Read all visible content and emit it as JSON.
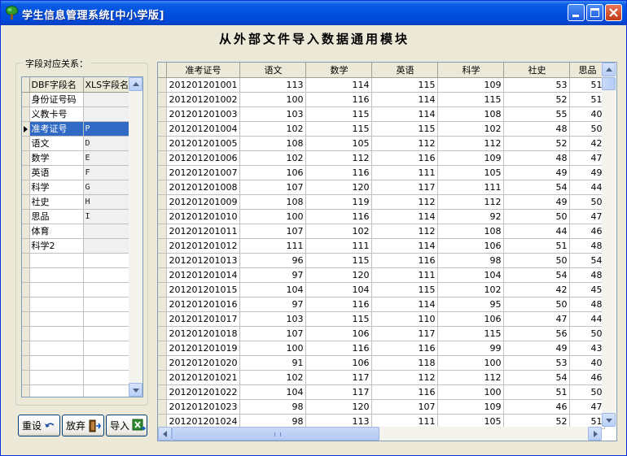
{
  "window": {
    "title": "学生信息管理系统[中小学版]"
  },
  "heading": "从外部文件导入数据通用模块",
  "mapping": {
    "legend": "字段对应关系：",
    "headers": {
      "dbf": "DBF字段名",
      "xls": "XLS字段名"
    },
    "selected_index": 2,
    "rows": [
      {
        "dbf": "身份证号码",
        "xls": ""
      },
      {
        "dbf": "义教卡号",
        "xls": ""
      },
      {
        "dbf": "准考证号",
        "xls": "P"
      },
      {
        "dbf": "语文",
        "xls": "D"
      },
      {
        "dbf": "数学",
        "xls": "E"
      },
      {
        "dbf": "英语",
        "xls": "F"
      },
      {
        "dbf": "科学",
        "xls": "G"
      },
      {
        "dbf": "社史",
        "xls": "H"
      },
      {
        "dbf": "思品",
        "xls": "I"
      },
      {
        "dbf": "体育",
        "xls": ""
      },
      {
        "dbf": "科学2",
        "xls": ""
      }
    ]
  },
  "buttons": {
    "reset": "重设",
    "discard": "放弃",
    "import": "导入"
  },
  "grid": {
    "columns": [
      "准考证号",
      "语文",
      "数学",
      "英语",
      "科学",
      "社史",
      "思品"
    ],
    "rows": [
      [
        "201201201001",
        "113",
        "114",
        "115",
        "109",
        "53",
        "51"
      ],
      [
        "201201201002",
        "100",
        "116",
        "114",
        "115",
        "52",
        "51"
      ],
      [
        "201201201003",
        "103",
        "115",
        "114",
        "108",
        "55",
        "40"
      ],
      [
        "201201201004",
        "102",
        "115",
        "115",
        "102",
        "48",
        "50"
      ],
      [
        "201201201005",
        "108",
        "105",
        "112",
        "112",
        "52",
        "42"
      ],
      [
        "201201201006",
        "102",
        "112",
        "116",
        "109",
        "48",
        "47"
      ],
      [
        "201201201007",
        "106",
        "116",
        "111",
        "105",
        "49",
        "49"
      ],
      [
        "201201201008",
        "107",
        "120",
        "117",
        "111",
        "54",
        "44"
      ],
      [
        "201201201009",
        "108",
        "119",
        "112",
        "112",
        "49",
        "50"
      ],
      [
        "201201201010",
        "100",
        "116",
        "114",
        "92",
        "50",
        "47"
      ],
      [
        "201201201011",
        "107",
        "102",
        "112",
        "108",
        "44",
        "46"
      ],
      [
        "201201201012",
        "111",
        "111",
        "114",
        "106",
        "51",
        "48"
      ],
      [
        "201201201013",
        "96",
        "115",
        "116",
        "98",
        "50",
        "54"
      ],
      [
        "201201201014",
        "97",
        "120",
        "111",
        "104",
        "54",
        "48"
      ],
      [
        "201201201015",
        "104",
        "104",
        "115",
        "102",
        "42",
        "45"
      ],
      [
        "201201201016",
        "97",
        "116",
        "114",
        "95",
        "50",
        "48"
      ],
      [
        "201201201017",
        "103",
        "115",
        "110",
        "106",
        "47",
        "44"
      ],
      [
        "201201201018",
        "107",
        "106",
        "117",
        "115",
        "56",
        "50"
      ],
      [
        "201201201019",
        "100",
        "116",
        "116",
        "99",
        "49",
        "43"
      ],
      [
        "201201201020",
        "91",
        "106",
        "118",
        "100",
        "53",
        "40"
      ],
      [
        "201201201021",
        "102",
        "117",
        "112",
        "112",
        "54",
        "46"
      ],
      [
        "201201201022",
        "104",
        "117",
        "116",
        "100",
        "51",
        "50"
      ],
      [
        "201201201023",
        "98",
        "120",
        "107",
        "109",
        "46",
        "47"
      ],
      [
        "201201201024",
        "98",
        "113",
        "111",
        "105",
        "52",
        "51"
      ]
    ]
  }
}
